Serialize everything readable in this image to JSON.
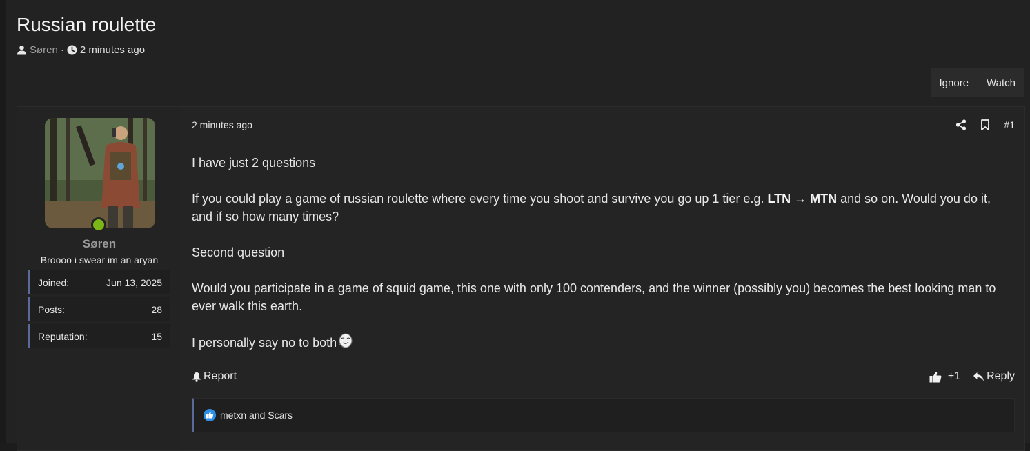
{
  "thread": {
    "title": "Russian roulette",
    "author": "Søren",
    "separator": "·",
    "time": "2 minutes ago"
  },
  "actions": {
    "ignore_label": "Ignore",
    "watch_label": "Watch"
  },
  "user": {
    "name": "Søren",
    "title": "Broooo i swear im an aryan",
    "online": true,
    "stats": [
      {
        "label": "Joined:",
        "value": "Jun 13, 2025"
      },
      {
        "label": "Posts:",
        "value": "28"
      },
      {
        "label": "Reputation:",
        "value": "15"
      }
    ]
  },
  "post": {
    "date": "2 minutes ago",
    "number": "#1",
    "para1": "I have just 2 questions",
    "para2_pre": "If you could play a game of russian roulette where every time you shoot and survive you go up 1 tier e.g. ",
    "para2_b1": "LTN",
    "para2_arrow": " → ",
    "para2_b2": "MTN",
    "para2_post": " and so on. Would you do it, and if so how many times?",
    "para3": "Second question",
    "para4": "Would you participate in a game of squid game, this one with only 100 contenders, and the winner (possibly you) becomes the best looking man to ever walk this earth.",
    "para5": "I personally say no to both"
  },
  "footer": {
    "report_label": "Report",
    "like_count": "+1",
    "reply_label": "Reply"
  },
  "reactions": {
    "text": "metxn and Scars"
  },
  "colors": {
    "background": "#222222",
    "online": "#7cb518",
    "accent_border": "#5a6a9a",
    "like_blue": "#2f8fe8"
  }
}
